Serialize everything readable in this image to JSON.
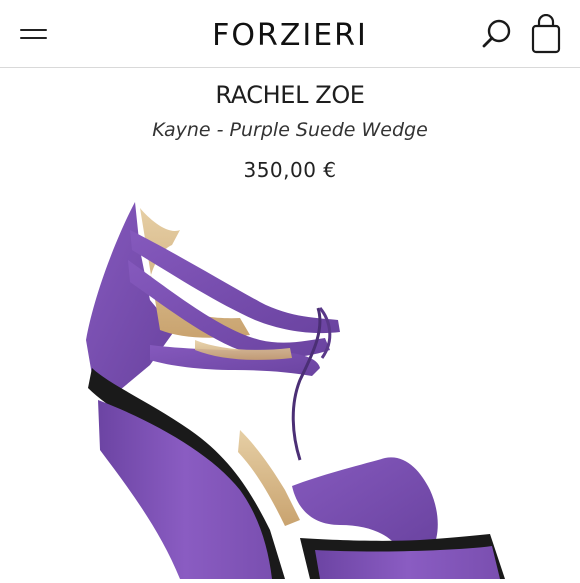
{
  "header": {
    "logo_text": "FORZIERI",
    "menu_icon": "hamburger-menu-icon",
    "search_icon": "search-icon",
    "bag_icon": "shopping-bag-icon"
  },
  "product": {
    "brand": "RACHEL ZOE",
    "name": "Kayne - Purple Suede Wedge",
    "price": "350,00 €",
    "image_icon": "purple-suede-wedge-sandal-photo"
  },
  "colors": {
    "suede": "#7a4fb0",
    "suede_dark": "#5e3a90",
    "platform": "#1a1a1a",
    "lining": "#d9b98c"
  }
}
